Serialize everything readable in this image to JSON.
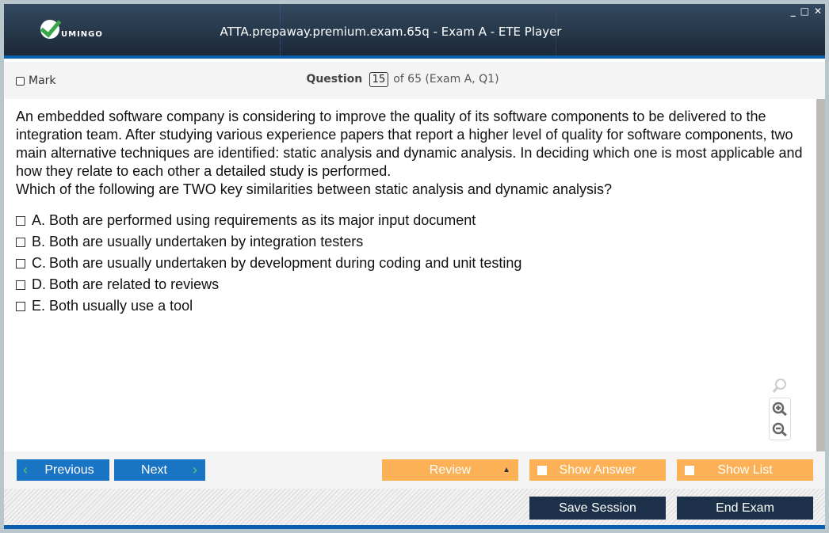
{
  "window": {
    "title": "ATTA.prepaway.premium.exam.65q - Exam A - ETE Player",
    "logo_text": "UMINGO",
    "minimize": "_",
    "maximize": "□",
    "close": "✕"
  },
  "toolbar": {
    "mark_label": "Mark",
    "question_label": "Question",
    "question_number": "15",
    "question_of": "of 65 (Exam A, Q1)"
  },
  "question": {
    "text": "An embedded software company is considering to improve the quality of its software components to be delivered to the integration team. After studying various experience papers that report a higher level of quality for software components, two main alternative techniques are identified: static analysis and dynamic analysis.  In deciding which one is most applicable and how they relate to each other a detailed study is performed.",
    "prompt": "Which of the following are TWO key similarities between static analysis and dynamic analysis?",
    "options": [
      {
        "letter": "A.",
        "text": "Both are performed using requirements as its major input document"
      },
      {
        "letter": "B.",
        "text": "Both are usually undertaken by integration testers"
      },
      {
        "letter": "C.",
        "text": "Both are usually undertaken by development during coding and unit testing"
      },
      {
        "letter": "D.",
        "text": "Both are related to reviews"
      },
      {
        "letter": "E.",
        "text": "Both usually use a tool"
      }
    ]
  },
  "buttons": {
    "previous": "Previous",
    "next": "Next",
    "review": "Review",
    "show_answer": "Show Answer",
    "show_list": "Show List",
    "save_session": "Save Session",
    "end_exam": "End Exam"
  }
}
